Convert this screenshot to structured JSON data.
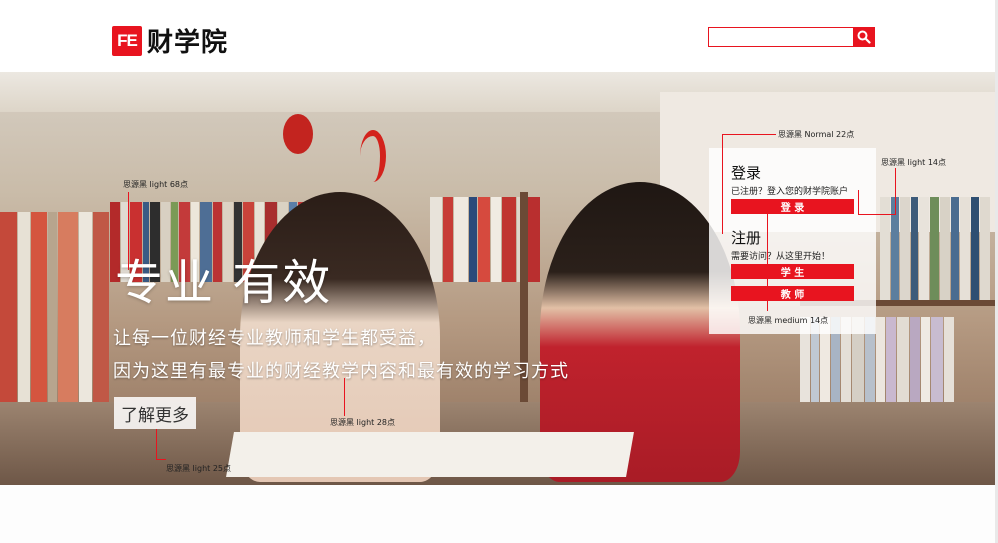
{
  "header": {
    "logo_mark": "FE",
    "logo_text": "财学院",
    "search": {
      "placeholder": ""
    },
    "accent_color": "#e8141f",
    "search_icon": "search-icon"
  },
  "hero": {
    "title": "专业 有效",
    "subtitle_line1": "让每一位财经专业教师和学生都受益，",
    "subtitle_line2": "因为这里有最专业的财经教学内容和最有效的学习方式",
    "learn_more": "了解更多"
  },
  "panel": {
    "login_heading": "登录",
    "login_text": "已注册？登入您的财学院账户",
    "login_button": "登 录",
    "register_heading": "注册",
    "register_text": "需要访问？从这里开始！",
    "student_button": "学 生",
    "teacher_button": "教 师"
  },
  "annotations": {
    "normal22": "思源黑 Normal 22点",
    "light14": "思源黑 light 14点",
    "light68": "思源黑 light 68点",
    "medium14": "思源黑 medium 14点",
    "light28": "思源黑 light 28点",
    "light25": "思源黑 light 25点"
  }
}
